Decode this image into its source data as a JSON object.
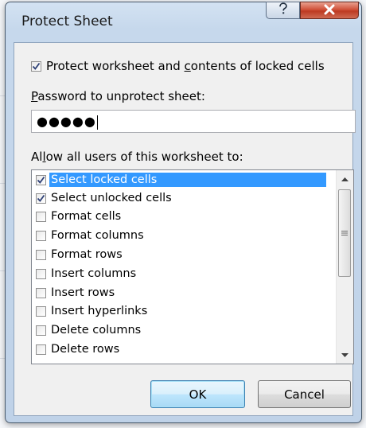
{
  "dialog": {
    "title": "Protect Sheet",
    "help_icon": "question-mark-icon",
    "close_icon": "close-x-icon"
  },
  "protect": {
    "checked": true,
    "label_pre": "Protect worksheet and ",
    "label_accel": "c",
    "label_post": "ontents of locked cells"
  },
  "password": {
    "label_accel": "P",
    "label_rest": "assword to unprotect sheet:",
    "value": "●●●●●"
  },
  "allow": {
    "label_pre": "Al",
    "label_accel": "l",
    "label_post": "ow all users of this worksheet to:"
  },
  "permissions": [
    {
      "label": "Select locked cells",
      "checked": true,
      "selected": true
    },
    {
      "label": "Select unlocked cells",
      "checked": true,
      "selected": false
    },
    {
      "label": "Format cells",
      "checked": false,
      "selected": false
    },
    {
      "label": "Format columns",
      "checked": false,
      "selected": false
    },
    {
      "label": "Format rows",
      "checked": false,
      "selected": false
    },
    {
      "label": "Insert columns",
      "checked": false,
      "selected": false
    },
    {
      "label": "Insert rows",
      "checked": false,
      "selected": false
    },
    {
      "label": "Insert hyperlinks",
      "checked": false,
      "selected": false
    },
    {
      "label": "Delete columns",
      "checked": false,
      "selected": false
    },
    {
      "label": "Delete rows",
      "checked": false,
      "selected": false
    }
  ],
  "buttons": {
    "ok": "OK",
    "cancel": "Cancel"
  },
  "colors": {
    "selection": "#3399ff",
    "close_button": "#c7432b",
    "ok_border": "#3c7fb1"
  }
}
